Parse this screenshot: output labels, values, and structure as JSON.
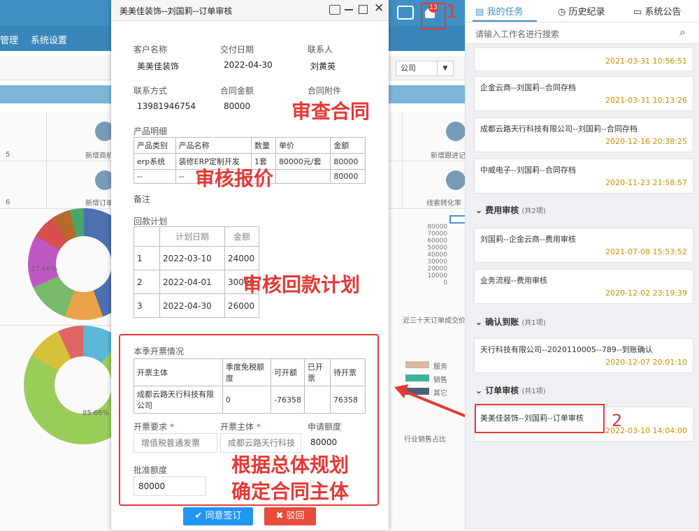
{
  "background": {
    "nav": [
      "管理",
      "系统设置"
    ],
    "filter_company": "公司",
    "cells": [
      {
        "num": "5",
        "label": "新增商机"
      },
      {
        "num": "6",
        "label": "新增订单"
      },
      {
        "label": "新增跟进记"
      },
      {
        "label": "线索转化率"
      }
    ],
    "donut1_pct": "27.66%",
    "donut2_pct": "85.66%",
    "bar_ticks": [
      "80000",
      "70000",
      "60000",
      "50000",
      "40000",
      "30000",
      "20000",
      "10000",
      "0"
    ],
    "bar_caption": "近三十天订单成交价",
    "legend": [
      "服务",
      "销售",
      "其它"
    ],
    "industry_caption": "行业销售占比"
  },
  "modal": {
    "title": "美美佳装饰--刘国莉--订单审核",
    "fields": {
      "customer_label": "客户名称",
      "customer": "美美佳装饰",
      "date_label": "交付日期",
      "date": "2022-04-30",
      "contact_label": "联系人",
      "contact": "刘黄英",
      "phone_label": "联系方式",
      "phone": "13981946754",
      "amount_label": "合同金额",
      "amount": "80000",
      "attach_label": "合同附件"
    },
    "product_title": "产品明细",
    "product_headers": [
      "产品类别",
      "产品名称",
      "数量",
      "单价",
      "金额"
    ],
    "product_rows": [
      [
        "erp系统",
        "装修ERP定制开发",
        "1套",
        "80000元/套",
        "80000"
      ],
      [
        "--",
        "--",
        "",
        "",
        "80000"
      ]
    ],
    "remark_label": "备注",
    "payment_title": "回款计划",
    "payment_headers": [
      "",
      "计划日期",
      "金额"
    ],
    "payment_rows": [
      [
        "1",
        "2022-03-10",
        "24000"
      ],
      [
        "2",
        "2022-04-01",
        "30000"
      ],
      [
        "3",
        "2022-04-30",
        "26000"
      ]
    ],
    "invoice_title": "本季开票情况",
    "invoice_headers": [
      "开票主体",
      "季度免税额度",
      "可开额",
      "已开票",
      "待开票"
    ],
    "invoice_row": [
      "成都云路天行科技有限公司",
      "0",
      "-76358",
      "",
      "76358"
    ],
    "invoice_req_label": "开票要求",
    "invoice_req_placeholder": "增值税普通发票",
    "invoice_entity_label": "开票主体",
    "invoice_entity_value": "成都云路天行科技",
    "apply_amount_label": "申请额度",
    "apply_amount": "80000",
    "approve_label": "批准额度",
    "approve_value": "80000",
    "btn_agree": "同意签订",
    "btn_reject": "驳回"
  },
  "annotations": {
    "n1": "1",
    "n2": "2",
    "review_contract": "审查合同",
    "review_quote": "审核报价",
    "review_payment": "审核回款计划",
    "entity_line1": "根据总体规划",
    "entity_line2": "确定合同主体"
  },
  "topbar": {
    "badge": "13"
  },
  "right_panel": {
    "tabs": [
      "我的任务",
      "历史纪录",
      "系统公告"
    ],
    "search_placeholder": "请输入工作名进行搜索",
    "top_cards": [
      {
        "title": "",
        "date": "2021-03-31 10:56:51"
      },
      {
        "title": "企金云商--刘国莉--合同存档",
        "date": "2021-03-31 10:13:26"
      },
      {
        "title": "成都云路天行科技有限公司--刘国莉--合同存档",
        "date": "2020-12-16 20:38:25"
      },
      {
        "title": "中威电子--刘国莉--合同存档",
        "date": "2020-11-23 21:58:57"
      }
    ],
    "group_fee": "费用审核",
    "group_fee_count": "(共2项)",
    "fee_cards": [
      {
        "title": "刘国莉--企金云商--费用审核",
        "date": "2021-07-08 15:53:52"
      },
      {
        "title": "业务流程--费用审核",
        "date": "2020-12-02 23:19:39"
      }
    ],
    "group_receipt": "确认到账",
    "group_receipt_count": "(共1项)",
    "receipt_cards": [
      {
        "title": "天行科技有限公司--2020110005--789--到账确认",
        "date": "2020-12-07 20:01:10"
      }
    ],
    "group_order": "订单审核",
    "group_order_count": "(共1项)",
    "order_cards": [
      {
        "title": "美美佳装饰--刘国莉--订单审核",
        "date": "2022-03-10 14:04:00"
      }
    ]
  },
  "colors": {
    "accent": "#3f8fc4",
    "annotation": "#e53935",
    "date": "#c99000",
    "agree": "#2196f3",
    "reject": "#e74c3c"
  }
}
